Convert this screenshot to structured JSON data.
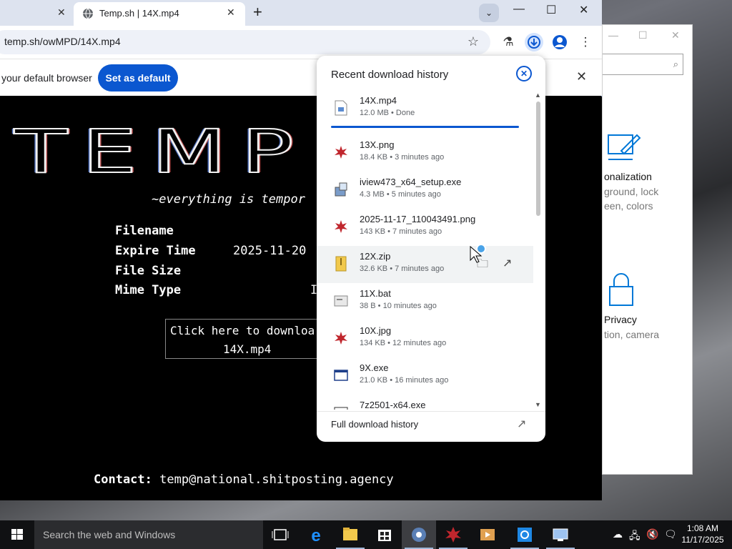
{
  "settings_window": {
    "search_icon": "search-icon",
    "personalization": {
      "title": "onalization",
      "sub1": "ground, lock",
      "sub2": "een, colors"
    },
    "privacy": {
      "title": "Privacy",
      "sub1": "tion, camera"
    }
  },
  "browser": {
    "tabs": [
      {
        "title": "",
        "active": false
      },
      {
        "title": "Temp.sh | 14X.mp4",
        "active": true
      }
    ],
    "url": "temp.sh/owMPD/14X.mp4",
    "infobar": {
      "message": "your default browser",
      "button": "Set as default"
    }
  },
  "page": {
    "logo": "TEMP",
    "tagline": "~everything is tempor",
    "fields": [
      {
        "label": "Filename",
        "value": ""
      },
      {
        "label": "Expire Time",
        "value": "2025-11-20"
      },
      {
        "label": "File Size",
        "value": ""
      },
      {
        "label": "Mime Type",
        "value": "I"
      }
    ],
    "download_line1": "Click here to downloa",
    "download_line2": "14X.mp4",
    "contact_label": "Contact:",
    "contact_value": "temp@national.shitposting.agency"
  },
  "download_bubble": {
    "title": "Recent download history",
    "items": [
      {
        "name": "14X.mp4",
        "meta": "12.0 MB • Done",
        "icon": "video-file-icon"
      },
      {
        "name": "13X.png",
        "meta": "18.4 KB • 3 minutes ago",
        "icon": "image-file-icon"
      },
      {
        "name": "iview473_x64_setup.exe",
        "meta": "4.3 MB • 5 minutes ago",
        "icon": "installer-icon"
      },
      {
        "name": "2025-11-17_110043491.png",
        "meta": "143 KB • 7 minutes ago",
        "icon": "image-file-icon"
      },
      {
        "name": "12X.zip",
        "meta": "32.6 KB • 7 minutes ago",
        "icon": "zip-file-icon"
      },
      {
        "name": "11X.bat",
        "meta": "38 B • 10 minutes ago",
        "icon": "batch-file-icon"
      },
      {
        "name": "10X.jpg",
        "meta": "134 KB • 12 minutes ago",
        "icon": "image-file-icon"
      },
      {
        "name": "9X.exe",
        "meta": "21.0 KB • 16 minutes ago",
        "icon": "exe-file-icon"
      },
      {
        "name": "7z2501-x64.exe",
        "meta": "",
        "icon": "exe-file-icon"
      }
    ],
    "footer": "Full download history"
  },
  "taskbar": {
    "search_placeholder": "Search the web and Windows",
    "time": "1:08 AM",
    "date": "11/17/2025"
  },
  "colors": {
    "accent": "#0b57d0",
    "page_bg": "#000000",
    "tab_strip": "#dde3ef"
  }
}
